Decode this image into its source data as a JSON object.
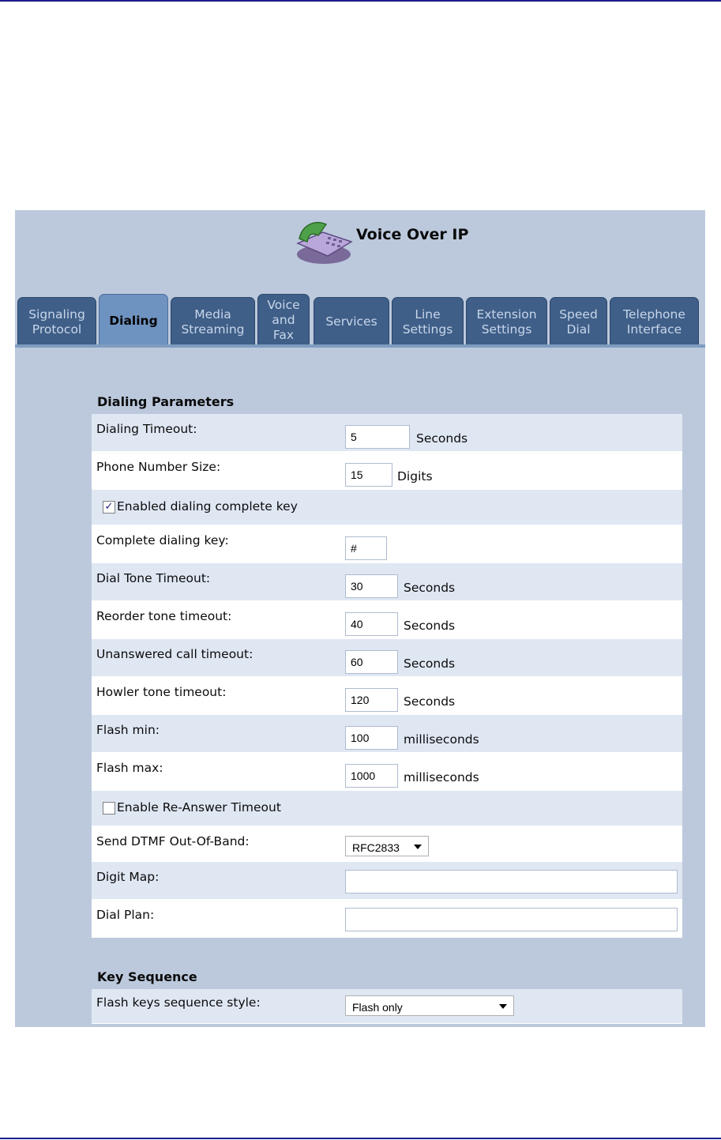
{
  "header": {
    "title": "Voice Over IP"
  },
  "tabs": [
    {
      "label": "Signaling\nProtocol",
      "active": false
    },
    {
      "label": "Dialing",
      "active": true
    },
    {
      "label": "Media\nStreaming",
      "active": false
    },
    {
      "label": "Voice\nand\nFax",
      "active": false
    },
    {
      "label": "Services",
      "active": false
    },
    {
      "label": "Line\nSettings",
      "active": false
    },
    {
      "label": "Extension\nSettings",
      "active": false
    },
    {
      "label": "Speed\nDial",
      "active": false
    },
    {
      "label": "Telephone\nInterface",
      "active": false
    }
  ],
  "dialing": {
    "section_title": "Dialing Parameters",
    "dialing_timeout": {
      "label": "Dialing Timeout:",
      "value": "5",
      "unit": "Seconds"
    },
    "phone_number_size": {
      "label": "Phone Number Size:",
      "value": "15",
      "unit": "Digits"
    },
    "enabled_complete_key": {
      "label": "Enabled dialing complete key",
      "checked": true
    },
    "complete_dialing_key": {
      "label": "Complete dialing key:",
      "value": "#"
    },
    "dial_tone_timeout": {
      "label": "Dial Tone Timeout:",
      "value": "30",
      "unit": "Seconds"
    },
    "reorder_tone_timeout": {
      "label": "Reorder tone timeout:",
      "value": "40",
      "unit": "Seconds"
    },
    "unanswered_call_timeout": {
      "label": "Unanswered call timeout:",
      "value": "60",
      "unit": "Seconds"
    },
    "howler_tone_timeout": {
      "label": "Howler tone timeout:",
      "value": "120",
      "unit": "Seconds"
    },
    "flash_min": {
      "label": "Flash min:",
      "value": "100",
      "unit": "milliseconds"
    },
    "flash_max": {
      "label": "Flash max:",
      "value": "1000",
      "unit": "milliseconds"
    },
    "reanswer_timeout": {
      "label": "Enable Re-Answer Timeout",
      "checked": false
    },
    "send_dtmf": {
      "label": "Send DTMF Out-Of-Band:",
      "value": "RFC2833"
    },
    "digit_map": {
      "label": "Digit Map:",
      "value": ""
    },
    "dial_plan": {
      "label": "Dial Plan:",
      "value": ""
    }
  },
  "key_sequence": {
    "section_title": "Key Sequence",
    "flash_keys_style": {
      "label": "Flash keys sequence style:",
      "value": "Flash only"
    }
  },
  "icons": {
    "phone": "phone-icon",
    "checkmark": "checkmark-icon",
    "dropdown": "chevron-down-icon"
  }
}
